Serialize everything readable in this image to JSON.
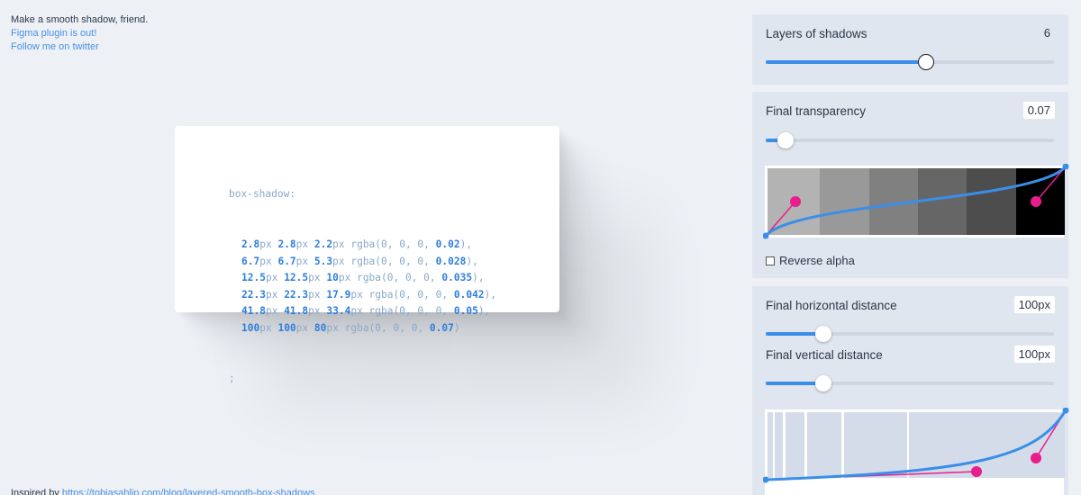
{
  "intro": {
    "headline": "Make a smooth shadow, friend.",
    "link_plugin": "Figma plugin is out!",
    "link_twitter": "Follow me on twitter"
  },
  "footer": {
    "prefix": "Inspired by ",
    "link": "https://tobiasahlin.com/blog/layered-smooth-box-shadows"
  },
  "code": {
    "property": "box-shadow:",
    "unit_px": "px",
    "rgba_prefix": " rgba(0, 0, 0, ",
    "rows": [
      {
        "x": "2.8",
        "y": "2.8",
        "blur": "2.2",
        "alpha": "0.02"
      },
      {
        "x": "6.7",
        "y": "6.7",
        "blur": "5.3",
        "alpha": "0.028"
      },
      {
        "x": "12.5",
        "y": "12.5",
        "blur": "10",
        "alpha": "0.035"
      },
      {
        "x": "22.3",
        "y": "22.3",
        "blur": "17.9",
        "alpha": "0.042"
      },
      {
        "x": "41.8",
        "y": "41.8",
        "blur": "33.4",
        "alpha": "0.05"
      },
      {
        "x": "100",
        "y": "100",
        "blur": "80",
        "alpha": "0.07"
      }
    ],
    "terminator": ";"
  },
  "controls": {
    "layers": {
      "label": "Layers of shadows",
      "value": "6",
      "slider_fraction": 0.557
    },
    "transparency": {
      "label": "Final transparency",
      "value": "0.07",
      "slider_fraction": 0.07
    },
    "reverse_alpha": {
      "label": "Reverse alpha",
      "checked": false
    },
    "horizontal": {
      "label": "Final horizontal distance",
      "value": "100px",
      "slider_fraction": 0.2
    },
    "vertical": {
      "label": "Final vertical distance",
      "value": "100px",
      "slider_fraction": 0.2
    }
  },
  "colors": {
    "accent": "#3a8ee8",
    "handle": "#e91e8c",
    "panel_bg": "#dfe6ef",
    "page_bg": "#edf1f6"
  }
}
